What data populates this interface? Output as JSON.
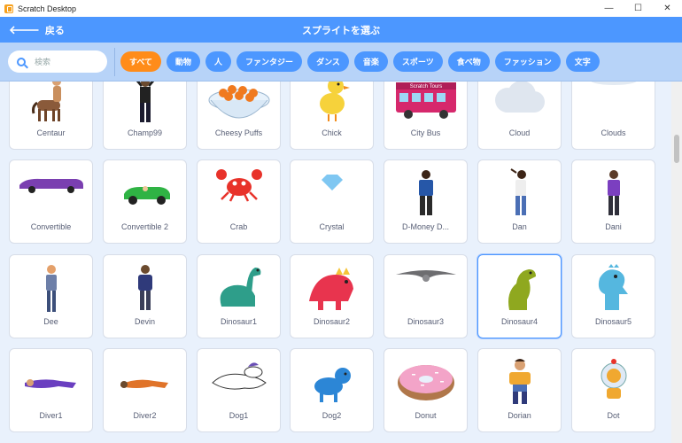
{
  "window": {
    "title": "Scratch Desktop",
    "min": "—",
    "max": "☐",
    "close": "✕"
  },
  "header": {
    "back_label": "戻る",
    "title": "スプライトを選ぶ"
  },
  "search": {
    "placeholder": "検索"
  },
  "tags": [
    "すべて",
    "動物",
    "人",
    "ファンタジー",
    "ダンス",
    "音楽",
    "スポーツ",
    "食べ物",
    "ファッション",
    "文字"
  ],
  "active_tag": "すべて",
  "sprites": [
    [
      "Centaur",
      "Champ99",
      "Cheesy Puffs",
      "Chick",
      "City Bus",
      "Cloud",
      "Clouds"
    ],
    [
      "Convertible",
      "Convertible 2",
      "Crab",
      "Crystal",
      "D-Money D...",
      "Dan",
      "Dani"
    ],
    [
      "Dee",
      "Devin",
      "Dinosaur1",
      "Dinosaur2",
      "Dinosaur3",
      "Dinosaur4",
      "Dinosaur5"
    ],
    [
      "Diver1",
      "Diver2",
      "Dog1",
      "Dog2",
      "Donut",
      "Dorian",
      "Dot"
    ]
  ],
  "selected_sprite": "Dinosaur4",
  "thumb_text": {
    "bus_sign": "Scratch Tours"
  },
  "colors": {
    "header": "#4c97ff",
    "filter_bar": "#b7d3f8",
    "active_tag": "#ff8c1a",
    "grid_bg": "#e9f1fc"
  }
}
